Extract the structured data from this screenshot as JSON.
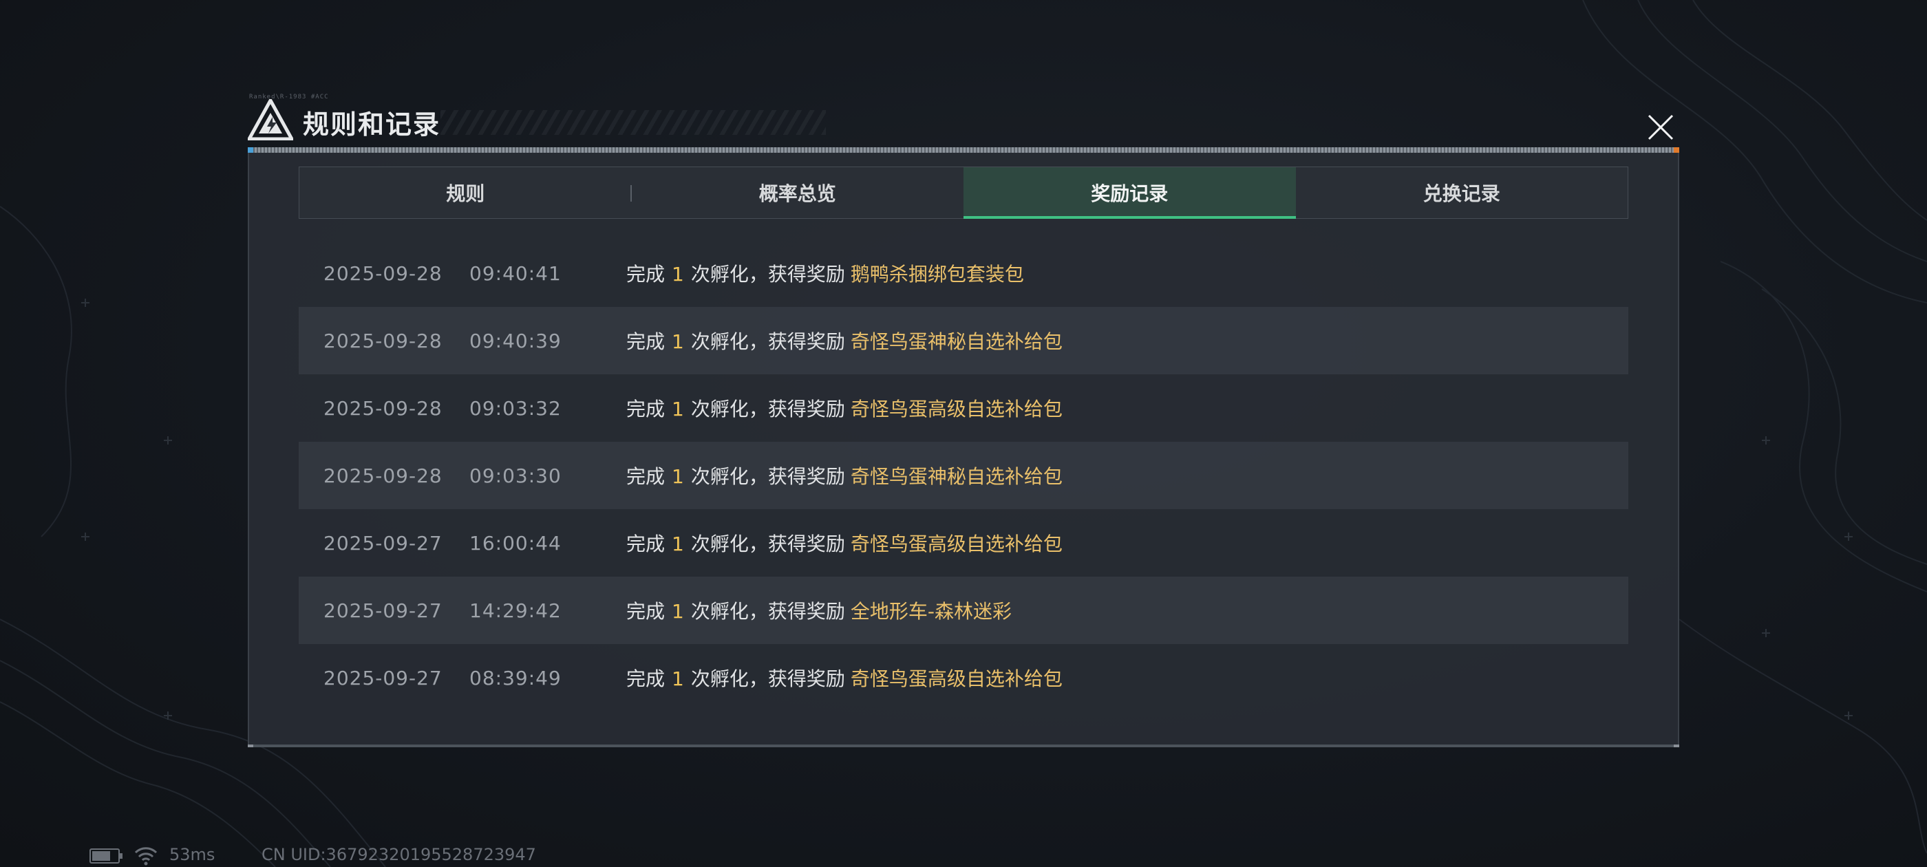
{
  "dialog": {
    "title": "规则和记录",
    "header_caption": "Ranked\\R-1983 #ACC",
    "tabs": [
      {
        "label": "规则",
        "active": false
      },
      {
        "label": "概率总览",
        "active": false
      },
      {
        "label": "奖励记录",
        "active": true
      },
      {
        "label": "兑换记录",
        "active": false
      }
    ],
    "records": [
      {
        "date": "2025-09-28",
        "time": "09:40:41",
        "prefix": "完成",
        "count": "1",
        "suffix": "次孵化，获得奖励",
        "reward": "鹅鸭杀捆绑包套装包"
      },
      {
        "date": "2025-09-28",
        "time": "09:40:39",
        "prefix": "完成",
        "count": "1",
        "suffix": "次孵化，获得奖励",
        "reward": "奇怪鸟蛋神秘自选补给包"
      },
      {
        "date": "2025-09-28",
        "time": "09:03:32",
        "prefix": "完成",
        "count": "1",
        "suffix": "次孵化，获得奖励",
        "reward": "奇怪鸟蛋高级自选补给包"
      },
      {
        "date": "2025-09-28",
        "time": "09:03:30",
        "prefix": "完成",
        "count": "1",
        "suffix": "次孵化，获得奖励",
        "reward": "奇怪鸟蛋神秘自选补给包"
      },
      {
        "date": "2025-09-27",
        "time": "16:00:44",
        "prefix": "完成",
        "count": "1",
        "suffix": "次孵化，获得奖励",
        "reward": "奇怪鸟蛋高级自选补给包"
      },
      {
        "date": "2025-09-27",
        "time": "14:29:42",
        "prefix": "完成",
        "count": "1",
        "suffix": "次孵化，获得奖励",
        "reward": "全地形车-森林迷彩"
      },
      {
        "date": "2025-09-27",
        "time": "08:39:49",
        "prefix": "完成",
        "count": "1",
        "suffix": "次孵化，获得奖励",
        "reward": "奇怪鸟蛋高级自选补给包"
      }
    ]
  },
  "status_bar": {
    "ping": "53ms",
    "uid": "CN UID:36792320195528723947"
  },
  "colors": {
    "accent_green": "#3fc083",
    "reward_gold": "#eac06a",
    "count_gold": "#f0c458"
  },
  "icons": {
    "logo": "triangle-logo-icon",
    "close": "close-icon",
    "battery": "battery-icon",
    "wifi": "wifi-icon"
  }
}
